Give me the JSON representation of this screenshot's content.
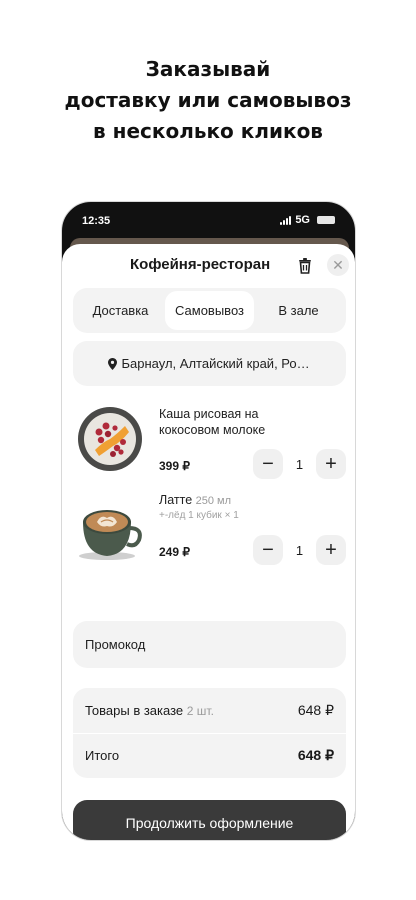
{
  "headline": {
    "line1": "Заказывай",
    "line2": "доставку или самовывоз",
    "line3": "в несколько кликов"
  },
  "status_bar": {
    "time": "12:35",
    "network": "5G"
  },
  "sheet": {
    "title": "Кофейня-ресторан"
  },
  "tabs": [
    {
      "label": "Доставка",
      "active": false
    },
    {
      "label": "Самовывоз",
      "active": true
    },
    {
      "label": "В зале",
      "active": false
    }
  ],
  "address": {
    "text": "Барнаул, Алтайский край, Россия"
  },
  "items": [
    {
      "name": "Каша рисовая на кокосовом молоке",
      "volume": "",
      "modifier": "",
      "price": "399 ₽",
      "qty": "1",
      "icon": "porridge-bowl"
    },
    {
      "name": "Латте",
      "volume": "250 мл",
      "modifier": "+-лёд 1 кубик × 1",
      "price": "249 ₽",
      "qty": "1",
      "icon": "latte-cup"
    }
  ],
  "promo": {
    "label": "Промокод"
  },
  "summary": {
    "items_label": "Товары в заказе",
    "items_count": "2 шт.",
    "items_total": "648 ₽",
    "total_label": "Итого",
    "total_value": "648 ₽"
  },
  "cta": {
    "label": "Продолжить оформление"
  },
  "colors": {
    "accent": "#3a3a3a",
    "surface": "#f3f3f3"
  }
}
